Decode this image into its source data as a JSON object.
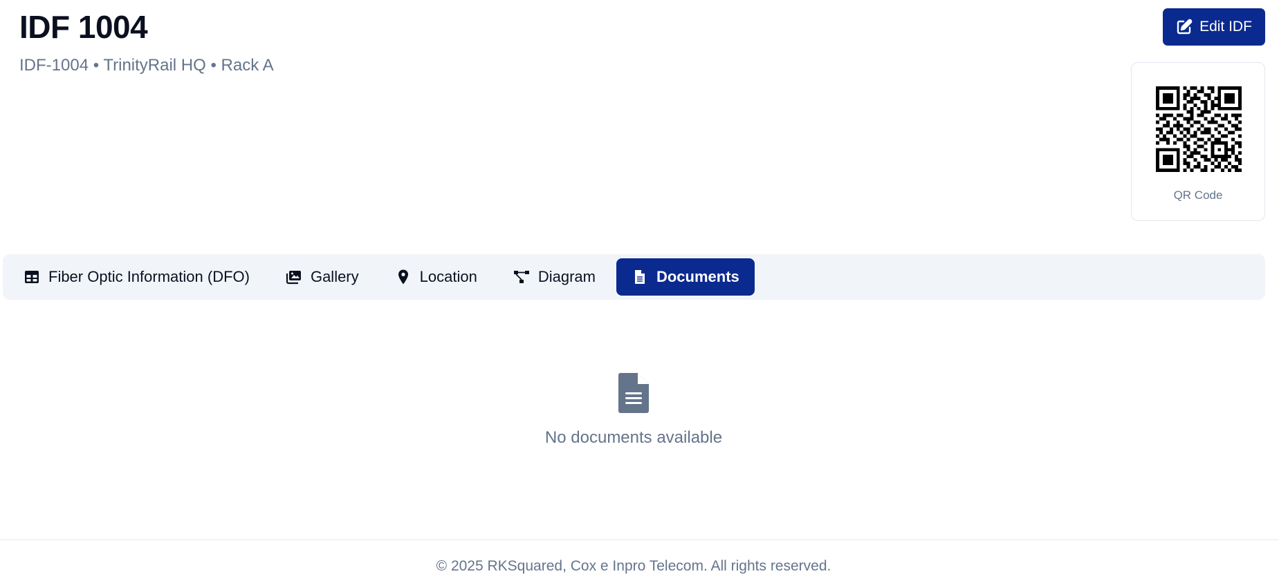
{
  "header": {
    "title": "IDF 1004",
    "subtitle": "IDF-1004 • TrinityRail HQ • Rack A",
    "edit_button_label": "Edit IDF",
    "edit_icon": "edit-icon"
  },
  "qr": {
    "label": "QR Code",
    "icon": "qr-code"
  },
  "tabs": [
    {
      "label": "Fiber Optic Information (DFO)",
      "icon": "table-icon",
      "active": false
    },
    {
      "label": "Gallery",
      "icon": "images-icon",
      "active": false
    },
    {
      "label": "Location",
      "icon": "map-pin-icon",
      "active": false
    },
    {
      "label": "Diagram",
      "icon": "diagram-icon",
      "active": false
    },
    {
      "label": "Documents",
      "icon": "document-icon",
      "active": true
    }
  ],
  "documents": {
    "empty_message": "No documents available",
    "empty_icon": "document-icon"
  },
  "footer": {
    "text": "© 2025 RKSquared, Cox e Inpro Telecom. All rights reserved."
  },
  "colors": {
    "primary": "#0b2a8f",
    "muted_text": "#64748b",
    "tabbar_bg": "#f1f5f9",
    "border": "#e2e8f0"
  }
}
